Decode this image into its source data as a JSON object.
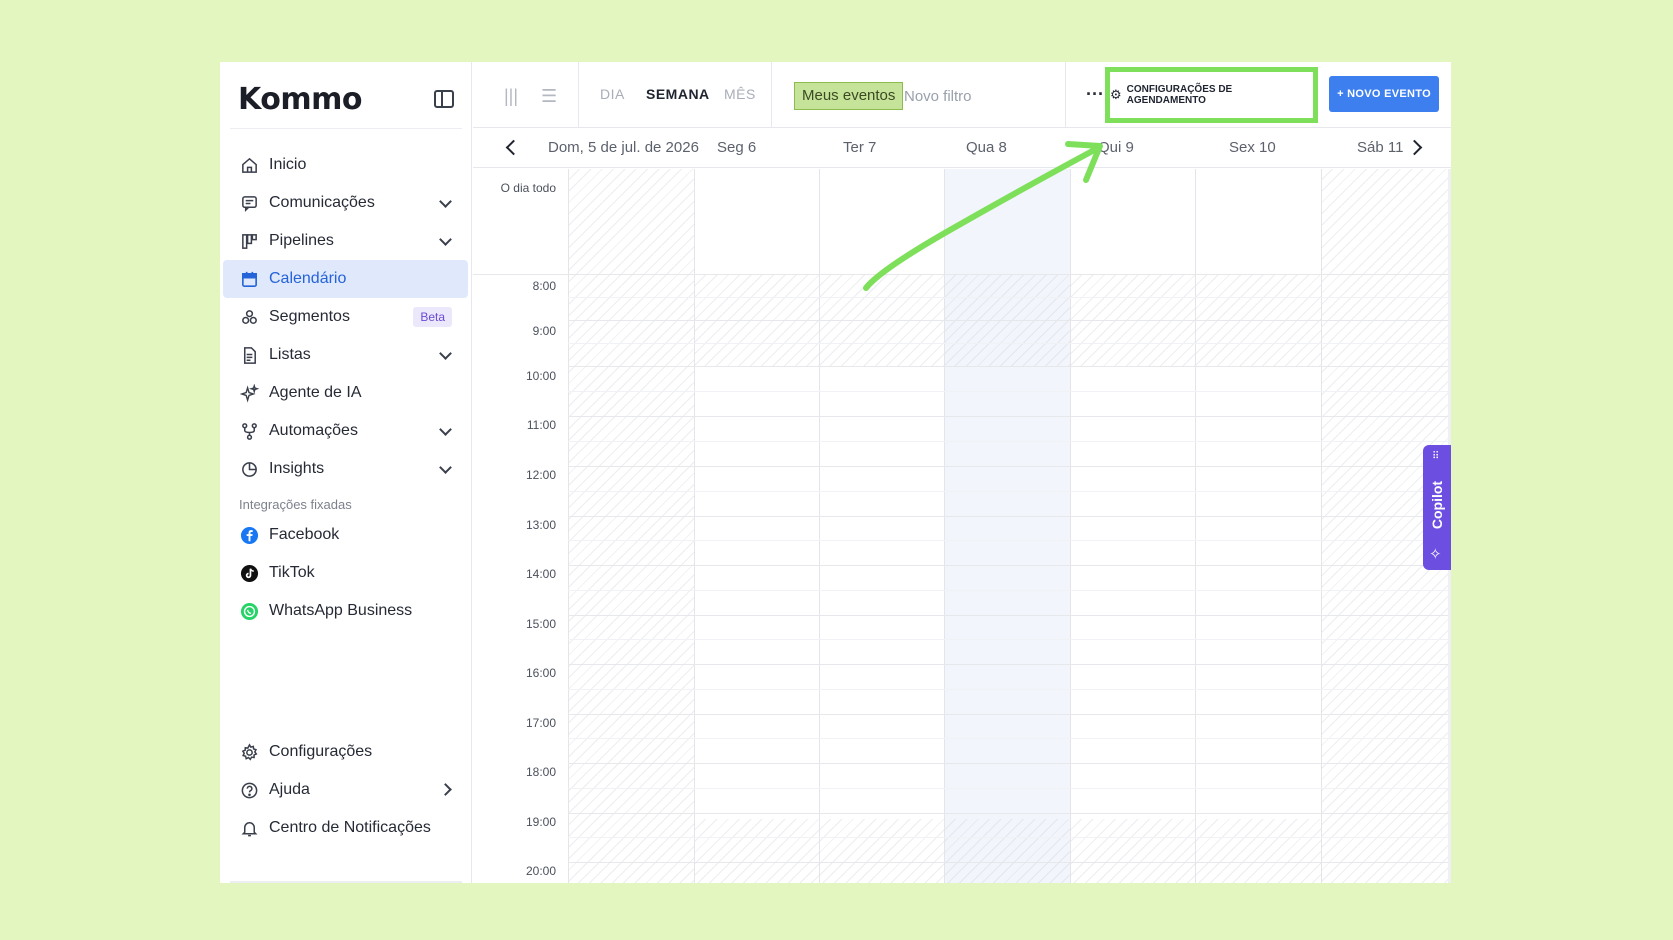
{
  "brand": {
    "logo": "Kommo"
  },
  "sidebar": {
    "items": [
      {
        "label": "Inicio",
        "icon": "home-icon",
        "expandable": false
      },
      {
        "label": "Comunicações",
        "icon": "chat-icon",
        "expandable": true
      },
      {
        "label": "Pipelines",
        "icon": "pipeline-icon",
        "expandable": true
      },
      {
        "label": "Calendário",
        "icon": "calendar-icon",
        "expandable": false,
        "active": true
      },
      {
        "label": "Segmentos",
        "icon": "segments-icon",
        "badge": "Beta"
      },
      {
        "label": "Listas",
        "icon": "list-icon",
        "expandable": true
      },
      {
        "label": "Agente de IA",
        "icon": "sparkle-icon",
        "expandable": false
      },
      {
        "label": "Automações",
        "icon": "automation-icon",
        "expandable": true
      },
      {
        "label": "Insights",
        "icon": "pie-chart-icon",
        "expandable": true
      }
    ],
    "integrations_title": "Integrações fixadas",
    "integrations": [
      {
        "label": "Facebook",
        "icon": "facebook-icon",
        "color": "#1877f2"
      },
      {
        "label": "TikTok",
        "icon": "tiktok-icon",
        "color": "#111111"
      },
      {
        "label": "WhatsApp Business",
        "icon": "whatsapp-icon",
        "color": "#25d366"
      }
    ],
    "bottom": [
      {
        "label": "Configurações",
        "icon": "gear-icon"
      },
      {
        "label": "Ajuda",
        "icon": "help-icon",
        "arrow": true
      },
      {
        "label": "Centro de Notificações",
        "icon": "bell-icon"
      }
    ]
  },
  "toolbar": {
    "modes": [
      "DIA",
      "SEMANA",
      "MÊS"
    ],
    "active_mode": "SEMANA",
    "filter_active": "Meus eventos",
    "filter_new": "Novo filtro",
    "more": "···",
    "schedule_settings": "CONFIGURAÇÕES DE AGENDAMENTO",
    "new_event": "+ NOVO EVENTO"
  },
  "calendar": {
    "days": [
      "Dom, 5 de jul. de 2026",
      "Seg 6",
      "Ter 7",
      "Qua 8",
      "Qui 9",
      "Sex 10",
      "Sáb 11"
    ],
    "all_day": "O dia todo",
    "hours": [
      "8:00",
      "9:00",
      "10:00",
      "11:00",
      "12:00",
      "13:00",
      "14:00",
      "15:00",
      "16:00",
      "17:00",
      "18:00",
      "19:00",
      "20:00"
    ]
  },
  "copilot": {
    "label": "Copilot"
  },
  "colors": {
    "accent": "#2563d8",
    "primary_button": "#3e7ff0",
    "highlight": "#7ee05a",
    "copilot": "#6c4ee0",
    "background": "#e4f6c0"
  }
}
